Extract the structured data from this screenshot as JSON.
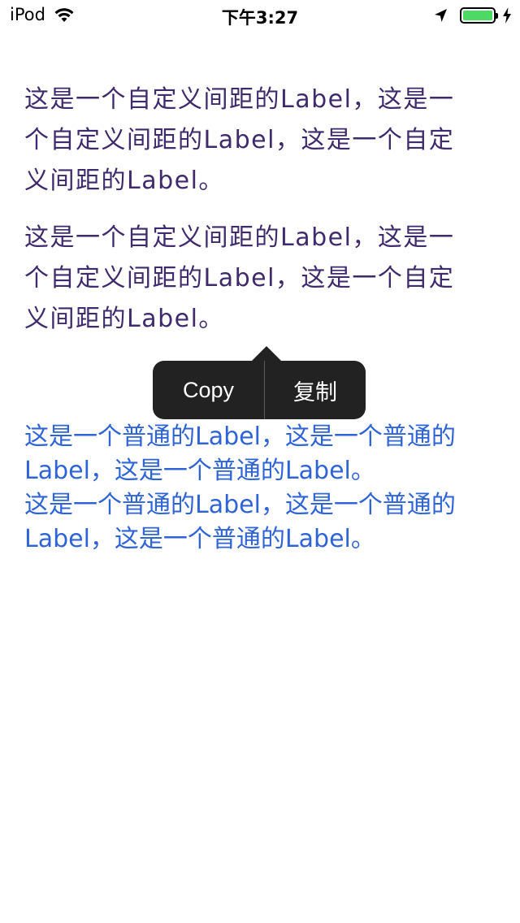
{
  "status_bar": {
    "carrier": "iPod",
    "time": "下午3:27",
    "battery_color": "#4cd964",
    "icons": [
      "wifi-icon",
      "location-arrow-icon",
      "battery-icon",
      "charging-bolt-icon"
    ]
  },
  "custom_spacing_labels": [
    {
      "text": "这是一个自定义间距的Label，这是一\n个自定义间距的Label，这是一个自定\n义间距的Label。"
    },
    {
      "text": "这是一个自定义间距的Label，这是一\n个自定义间距的Label，这是一个自定\n义间距的Label。"
    }
  ],
  "normal_labels": [
    {
      "text": "这是一个普通的Label，这是一个普通的\nLabel，这是一个普通的Label。"
    },
    {
      "text": "这是一个普通的Label，这是一个普通的\nLabel，这是一个普通的Label。"
    }
  ],
  "edit_menu": {
    "items": [
      {
        "label": "Copy"
      },
      {
        "label": "复制"
      }
    ],
    "background": "#222222"
  },
  "colors": {
    "custom_label": "#3e2a6c",
    "normal_label": "#2f64d6"
  }
}
